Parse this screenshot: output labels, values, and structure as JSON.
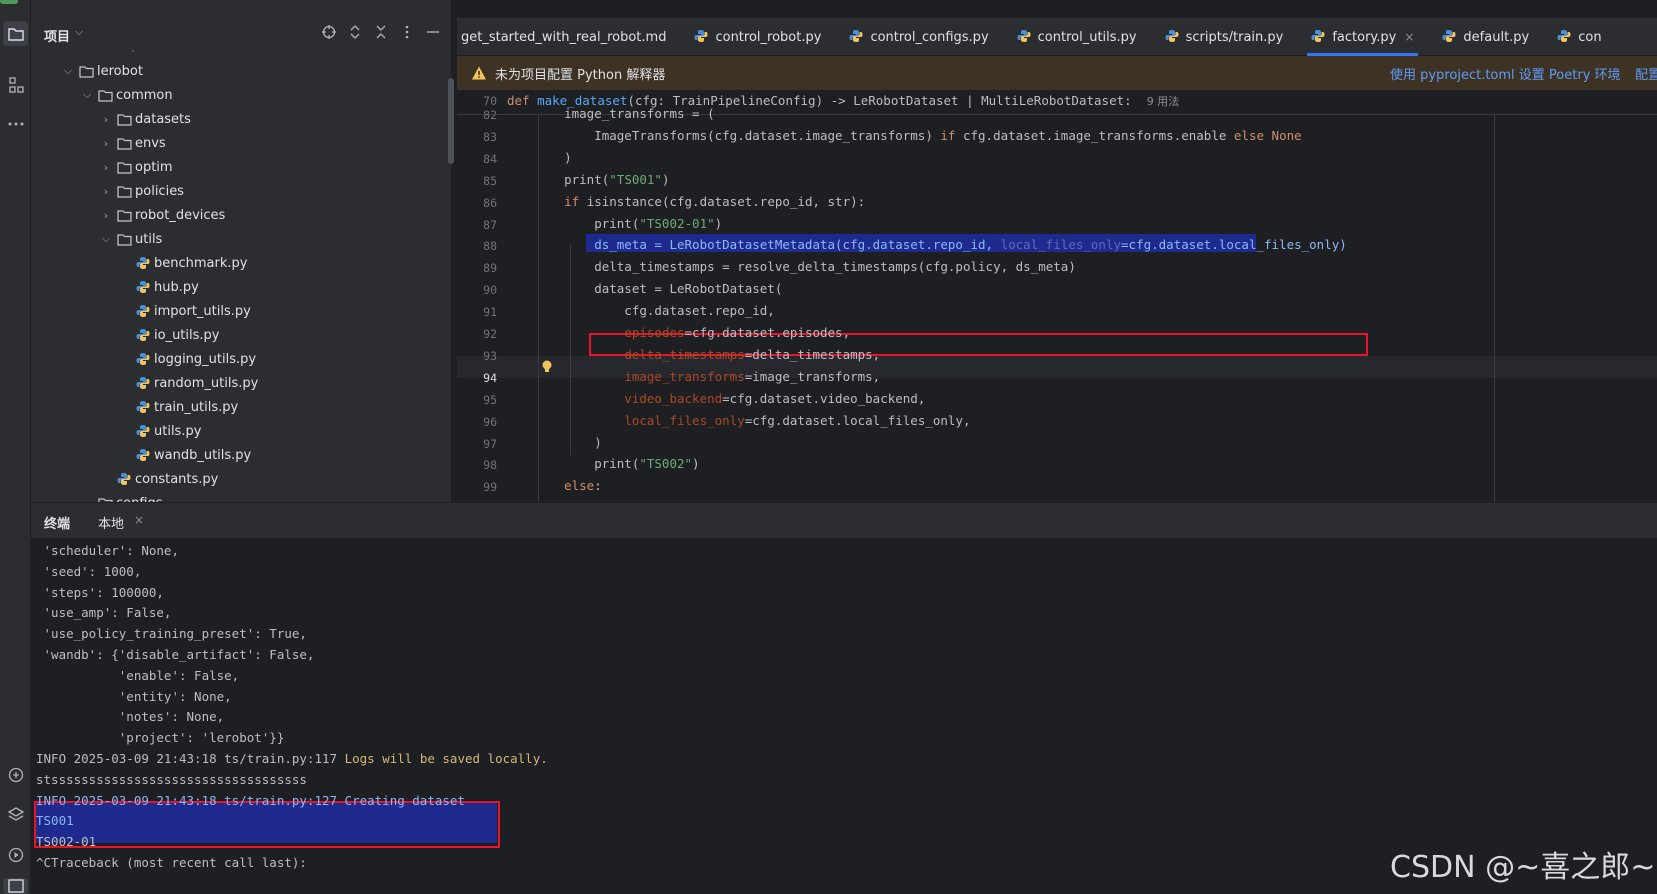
{
  "window": {
    "top_strip_colors": [
      "#4f9a5a",
      "#6e7278",
      "#c94f4f"
    ]
  },
  "project_panel": {
    "title": "项目",
    "chevron": "⌵",
    "tools": [
      "crosshair-icon",
      "expand-collapse-icon",
      "close-tree-icon",
      "more-icon",
      "minimize-icon"
    ],
    "tree": [
      {
        "label": "lerobot",
        "type": "folder",
        "state": "expanded",
        "depth": 1
      },
      {
        "label": "common",
        "type": "folder",
        "state": "expanded",
        "depth": 2
      },
      {
        "label": "datasets",
        "type": "folder",
        "state": "collapsed",
        "depth": 3
      },
      {
        "label": "envs",
        "type": "folder",
        "state": "collapsed",
        "depth": 3
      },
      {
        "label": "optim",
        "type": "folder",
        "state": "collapsed",
        "depth": 3
      },
      {
        "label": "policies",
        "type": "folder",
        "state": "collapsed",
        "depth": 3
      },
      {
        "label": "robot_devices",
        "type": "folder",
        "state": "collapsed",
        "depth": 3
      },
      {
        "label": "utils",
        "type": "folder",
        "state": "expanded",
        "depth": 3
      },
      {
        "label": "benchmark.py",
        "type": "python",
        "depth": 4
      },
      {
        "label": "hub.py",
        "type": "python",
        "depth": 4
      },
      {
        "label": "import_utils.py",
        "type": "python",
        "depth": 4
      },
      {
        "label": "io_utils.py",
        "type": "python",
        "depth": 4
      },
      {
        "label": "logging_utils.py",
        "type": "python",
        "depth": 4
      },
      {
        "label": "random_utils.py",
        "type": "python",
        "depth": 4
      },
      {
        "label": "train_utils.py",
        "type": "python",
        "depth": 4
      },
      {
        "label": "utils.py",
        "type": "python",
        "depth": 4
      },
      {
        "label": "wandb_utils.py",
        "type": "python",
        "depth": 4
      },
      {
        "label": "constants.py",
        "type": "python",
        "depth": 3
      },
      {
        "label": "configs",
        "type": "folder",
        "state": "collapsed",
        "depth": 2
      }
    ]
  },
  "tabs": [
    {
      "label": "get_started_with_real_robot.md",
      "icon": "markdown",
      "active": false
    },
    {
      "label": "control_robot.py",
      "icon": "python",
      "active": false
    },
    {
      "label": "control_configs.py",
      "icon": "python",
      "active": false
    },
    {
      "label": "control_utils.py",
      "icon": "python",
      "active": false
    },
    {
      "label": "scripts/train.py",
      "icon": "python",
      "active": false
    },
    {
      "label": "factory.py",
      "icon": "python",
      "active": true
    },
    {
      "label": "default.py",
      "icon": "python",
      "active": false
    },
    {
      "label": "con",
      "icon": "python",
      "active": false
    }
  ],
  "banner": {
    "message": "未为项目配置 Python 解释器",
    "action": "使用 pyproject.toml 设置 Poetry 环境",
    "action2": "配置"
  },
  "editor": {
    "sticky_line_number": "70",
    "sticky_usages": "9 用法",
    "current_line": "94",
    "lines": [
      {
        "n": "82",
        "text": "    image_transforms = ("
      },
      {
        "n": "83",
        "text": "        ImageTransforms(cfg.dataset.image_transforms) if cfg.dataset.image_transforms.enable else None"
      },
      {
        "n": "84",
        "text": "    )"
      },
      {
        "n": "85",
        "text": "    print(\"TS001\")"
      },
      {
        "n": "86",
        "text": "    if isinstance(cfg.dataset.repo_id, str):"
      },
      {
        "n": "87",
        "text": "        print(\"TS002-01\")"
      },
      {
        "n": "88",
        "text": "        ds_meta = LeRobotDatasetMetadata(cfg.dataset.repo_id, local_files_only=cfg.dataset.local_files_only)"
      },
      {
        "n": "89",
        "text": "        delta_timestamps = resolve_delta_timestamps(cfg.policy, ds_meta)"
      },
      {
        "n": "90",
        "text": "        dataset = LeRobotDataset("
      },
      {
        "n": "91",
        "text": "            cfg.dataset.repo_id,"
      },
      {
        "n": "92",
        "text": "            episodes=cfg.dataset.episodes,"
      },
      {
        "n": "93",
        "text": "            delta_timestamps=delta_timestamps,"
      },
      {
        "n": "94",
        "text": "            image_transforms=image_transforms,"
      },
      {
        "n": "95",
        "text": "            video_backend=cfg.dataset.video_backend,"
      },
      {
        "n": "96",
        "text": "            local_files_only=cfg.dataset.local_files_only,"
      },
      {
        "n": "97",
        "text": "        )"
      },
      {
        "n": "98",
        "text": "        print(\"TS002\")"
      },
      {
        "n": "99",
        "text": "    else:"
      }
    ]
  },
  "terminal": {
    "title": "终端",
    "tab": "本地",
    "tab_close": "×",
    "lines": [
      " 'scheduler': None,",
      " 'seed': 1000,",
      " 'steps': 100000,",
      " 'use_amp': False,",
      " 'use_policy_training_preset': True,",
      " 'wandb': {'disable_artifact': False,",
      "           'enable': False,",
      "           'entity': None,",
      "           'notes': None,",
      "           'project': 'lerobot'}}",
      "INFO 2025-03-09 21:43:18 ts/train.py:117 ",
      "stssssssssssssssssssssssssssssssssss",
      "INFO 2025-03-09 21:43:18 ts/train.py:127 Creating dataset",
      "TS001",
      "TS002-01",
      "^CTraceback (most recent call last):"
    ],
    "info117_message": "Logs will be saved locally."
  },
  "watermark": "CSDN @~喜之郎~"
}
